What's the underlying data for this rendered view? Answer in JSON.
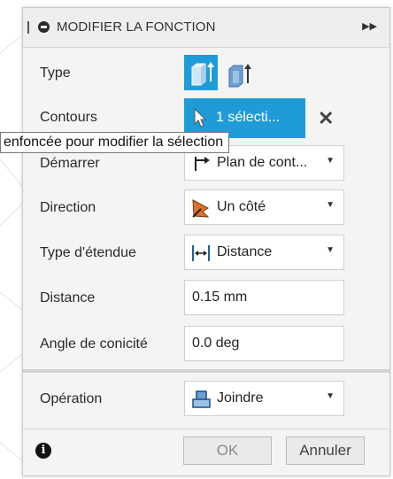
{
  "dialog": {
    "title": "MODIFIER LA FONCTION"
  },
  "rows": {
    "type": {
      "label": "Type"
    },
    "contours": {
      "label": "Contours",
      "selection": "1 sélecti..."
    },
    "demarrer": {
      "label": "Démarrer",
      "value": "Plan de cont..."
    },
    "direction": {
      "label": "Direction",
      "value": "Un côté"
    },
    "type_etendue": {
      "label": "Type d'étendue",
      "value": "Distance"
    },
    "distance": {
      "label": "Distance",
      "value": "0.15 mm"
    },
    "angle": {
      "label": "Angle de conicité",
      "value": "0.0 deg"
    },
    "operation": {
      "label": "Opération",
      "value": "Joindre"
    }
  },
  "buttons": {
    "ok": "OK",
    "cancel": "Annuler"
  },
  "tooltip": {
    "text": "enfoncée pour modifier la sélection"
  },
  "icons": {
    "title": "minus-circle-icon",
    "expand": "double-chevron-right-icon",
    "type_solid": "extrude-solid-icon",
    "type_thin": "extrude-thin-icon",
    "cursor": "cursor-arrow-icon",
    "clear": "close-icon",
    "start": "start-plane-icon",
    "direction": "one-side-direction-icon",
    "extent": "distance-extent-icon",
    "operation": "join-icon",
    "info": "info-icon"
  },
  "colors": {
    "accent": "#1f9cd8",
    "orange": "#e0702a"
  }
}
